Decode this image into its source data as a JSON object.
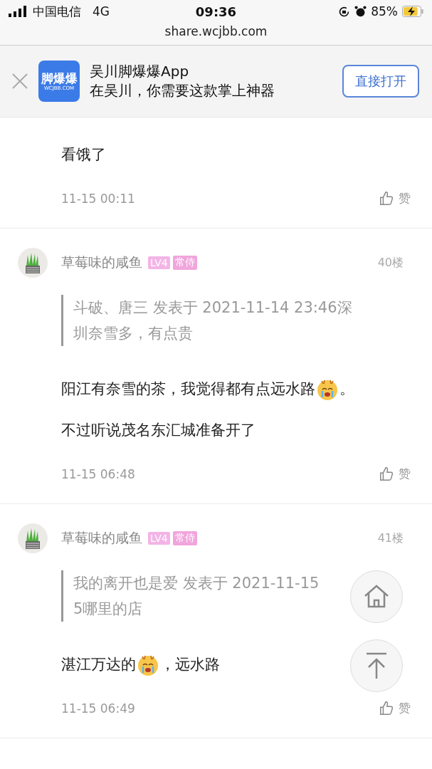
{
  "status_bar": {
    "carrier": "中国电信",
    "network": "4G",
    "time": "09:36",
    "battery": "85%",
    "charging": true
  },
  "url": "share.wcjbb.com",
  "banner": {
    "logo_title": "脚爆爆",
    "logo_domain": "WCJBB.COM",
    "title": "吴川脚爆爆App",
    "subtitle": "在吴川，你需要这款掌上神器",
    "button": "直接打开"
  },
  "posts": [
    {
      "paragraphs": [
        [
          {
            "kind": "text",
            "text": "看饿了"
          }
        ]
      ],
      "time": "11-15 00:11",
      "like": "赞"
    },
    {
      "name": "草莓味的咸鱼",
      "badges": [
        {
          "text": "LV4",
          "color": "#f3b4e6"
        },
        {
          "text": "常侍",
          "color": "#f0a6dc"
        }
      ],
      "floor": "40楼",
      "quote": [
        "斗破、唐三 发表于 2021-11-14 23:46深",
        "圳奈雪多，有点贵"
      ],
      "paragraphs": [
        [
          {
            "kind": "text",
            "text": "阳江有奈雪的茶，我觉得都有点远水路"
          },
          {
            "kind": "emoji"
          },
          {
            "kind": "text",
            "text": "。"
          }
        ],
        [
          {
            "kind": "text",
            "text": "不过听说茂名东汇城准备开了"
          }
        ]
      ],
      "time": "11-15 06:48",
      "like": "赞"
    },
    {
      "name": "草莓味的咸鱼",
      "badges": [
        {
          "text": "LV4",
          "color": "#f3b4e6"
        },
        {
          "text": "常侍",
          "color": "#f0a6dc"
        }
      ],
      "floor": "41楼",
      "quote": [
        "我的离开也是爱 发表于 2021-11-15",
        "5哪里的店"
      ],
      "paragraphs": [
        [
          {
            "kind": "text",
            "text": "湛江万达的"
          },
          {
            "kind": "emoji"
          },
          {
            "kind": "text",
            "text": "，远水路"
          }
        ]
      ],
      "time": "11-15 06:49",
      "like": "赞"
    }
  ]
}
